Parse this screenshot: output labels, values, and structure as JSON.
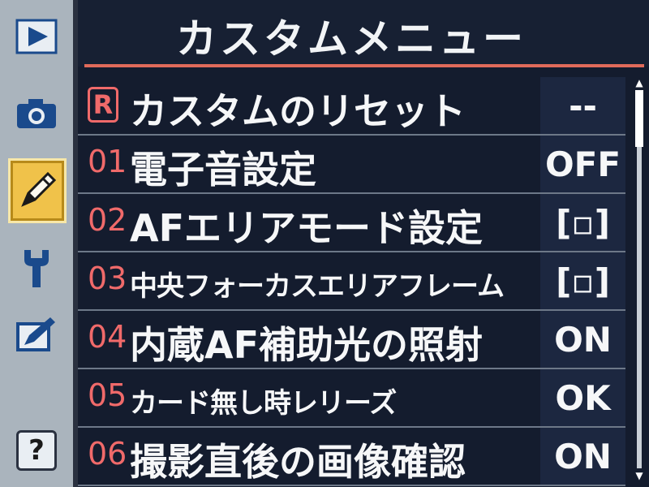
{
  "title": "カスタムメニュー",
  "rail": {
    "items": [
      {
        "icon": "playback-icon"
      },
      {
        "icon": "camera-icon"
      },
      {
        "icon": "pencil-icon",
        "active": true
      },
      {
        "icon": "wrench-icon"
      },
      {
        "icon": "retouch-icon"
      },
      {
        "icon": "help-icon",
        "label": "?"
      }
    ]
  },
  "menu": {
    "items": [
      {
        "num": "R",
        "label": "カスタムのリセット",
        "value": "--"
      },
      {
        "num": "01",
        "label": "電子音設定",
        "value": "OFF"
      },
      {
        "num": "02",
        "label": "AFエリアモード設定",
        "value": "[▫]"
      },
      {
        "num": "03",
        "label": "中央フォーカスエリアフレーム",
        "value": "[▫]"
      },
      {
        "num": "04",
        "label": "内蔵AF補助光の照射",
        "value": "ON"
      },
      {
        "num": "05",
        "label": "カード無し時レリーズ",
        "value": "OK"
      },
      {
        "num": "06",
        "label": "撮影直後の画像確認",
        "value": "ON"
      }
    ]
  },
  "colors": {
    "accent_red": "#f06a6a",
    "active_yellow": "#f0c24a",
    "background": "#141c2e",
    "text": "#f6f7f8"
  }
}
